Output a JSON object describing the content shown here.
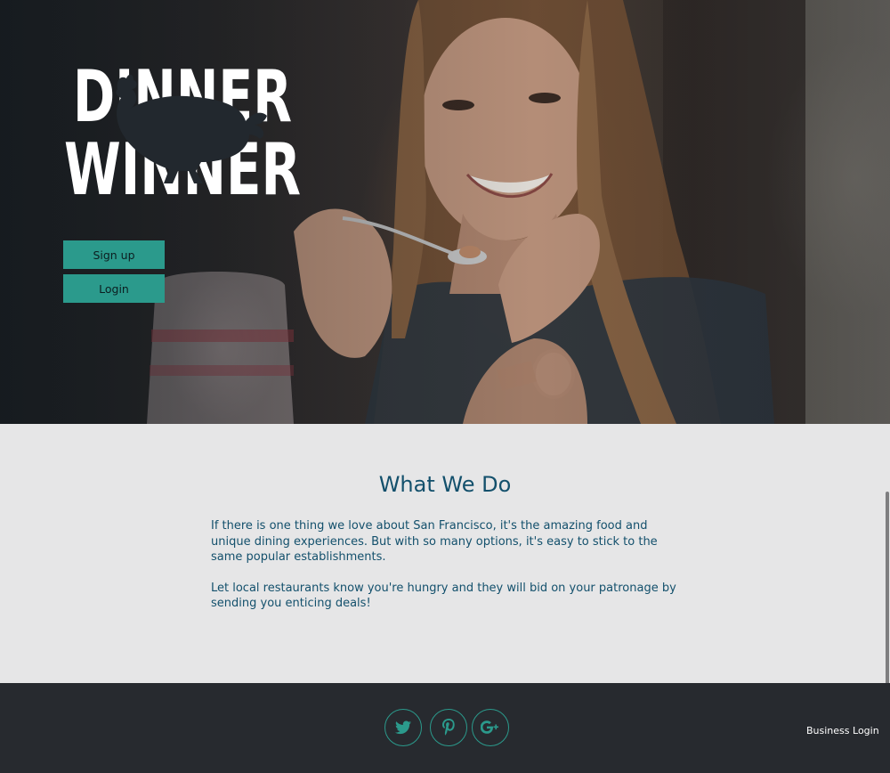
{
  "hero": {
    "logo_text": [
      "DINNER",
      "WINNER"
    ],
    "signup_label": "Sign up",
    "login_label": "Login"
  },
  "about": {
    "title": "What We Do",
    "paragraphs": [
      "If there is one thing we love about San Francisco, it's the amazing food and unique dining experiences. But with so many options, it's easy to stick to the same popular establishments.",
      "Let local restaurants know you're hungry and they will bid on your patronage by sending you enticing deals!"
    ]
  },
  "footer": {
    "social_icons": [
      "twitter-icon",
      "pinterest-icon",
      "google-plus-icon"
    ],
    "business_login_label": "Business Login"
  },
  "colors": {
    "accent": "#2b9a8c",
    "heading": "#13506c",
    "section_bg": "#e6e6e7",
    "footer_bg": "#272a2f"
  }
}
